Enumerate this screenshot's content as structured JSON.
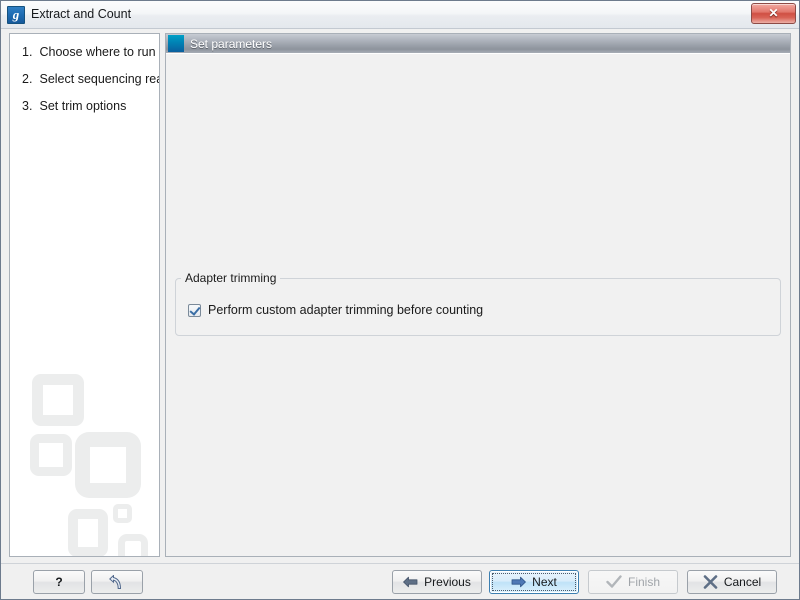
{
  "window": {
    "title": "Extract and Count",
    "app_icon": "genomics-workbench-icon",
    "icon_glyph": "g",
    "close_label": "✕",
    "accent_color": "#0a5f9e",
    "close_color": "#cf4f43"
  },
  "sidebar": {
    "steps": [
      {
        "number": "1.",
        "label": "Choose where to run"
      },
      {
        "number": "2.",
        "label": "Select sequencing reads"
      },
      {
        "number": "3.",
        "label": "Set trim options"
      }
    ]
  },
  "panel": {
    "header_title": "Set parameters",
    "header_icon": "blue-square-icon"
  },
  "groupbox": {
    "title": "Adapter trimming",
    "checkbox": {
      "label": "Perform custom adapter trimming before counting",
      "checked": true
    }
  },
  "bottombar": {
    "help_label": "?",
    "reset_label": "reset-arrow-icon",
    "buttons": [
      {
        "id": "previous",
        "label": "Previous",
        "icon": "arrow-left-icon",
        "state": "enabled"
      },
      {
        "id": "next",
        "label": "Next",
        "icon": "arrow-right-icon",
        "state": "focused"
      },
      {
        "id": "finish",
        "label": "Finish",
        "icon": "checkmark-icon",
        "state": "disabled"
      },
      {
        "id": "cancel",
        "label": "Cancel",
        "icon": "x-icon",
        "state": "enabled"
      }
    ]
  }
}
